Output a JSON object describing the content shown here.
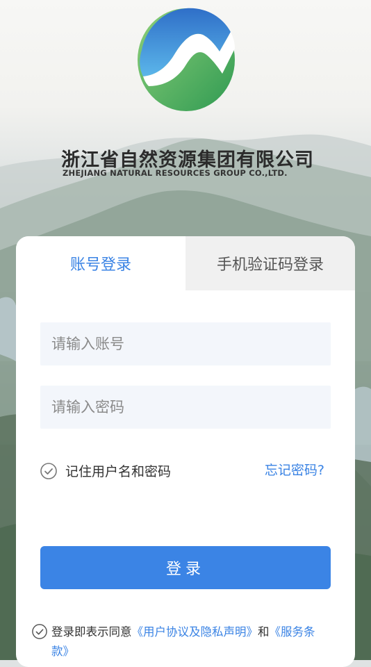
{
  "company": {
    "name_cn": "浙江省自然资源集团有限公司",
    "name_en": "ZHEJIANG NATURAL RESOURCES GROUP CO.,LTD."
  },
  "tabs": [
    {
      "label": "账号登录",
      "active": true
    },
    {
      "label": "手机验证码登录",
      "active": false
    }
  ],
  "form": {
    "account_placeholder": "请输入账号",
    "password_placeholder": "请输入密码",
    "remember_label": "记住用户名和密码",
    "forgot_label": "忘记密码?",
    "login_label": "登录"
  },
  "agreement": {
    "prefix": "登录即表示同意",
    "privacy_link": "《用户协议及隐私声明》",
    "conjunction": "和",
    "terms_link": "《服务条款》"
  },
  "colors": {
    "accent": "#3b84e5",
    "inactive_tab_bg": "#f0f0f0",
    "input_bg": "#f3f6fb"
  }
}
